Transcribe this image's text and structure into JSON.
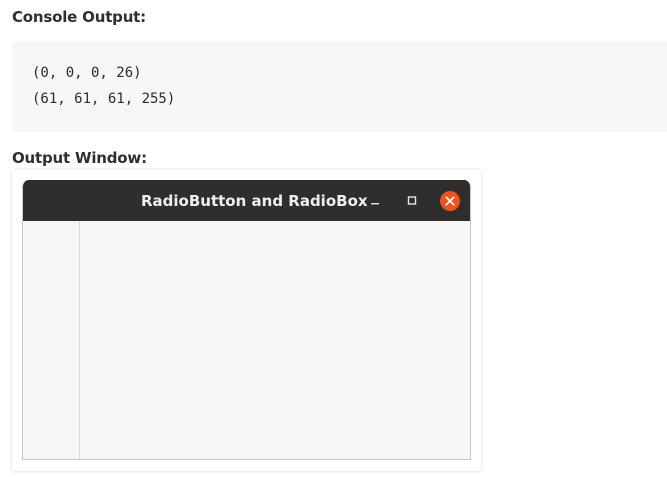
{
  "headings": {
    "console": "Console Output:",
    "output": "Output Window:"
  },
  "console": {
    "lines": [
      "(0, 0, 0, 26)",
      "(61, 61, 61, 255)"
    ]
  },
  "window": {
    "title": "RadioButton and RadioBox",
    "buttons": {
      "minimize_icon": "minimize-icon",
      "maximize_icon": "maximize-icon",
      "close_icon": "close-icon"
    },
    "colors": {
      "titlebar": "#302e2c",
      "close_button": "#e95420",
      "client_background": "#f6f6f6"
    }
  }
}
